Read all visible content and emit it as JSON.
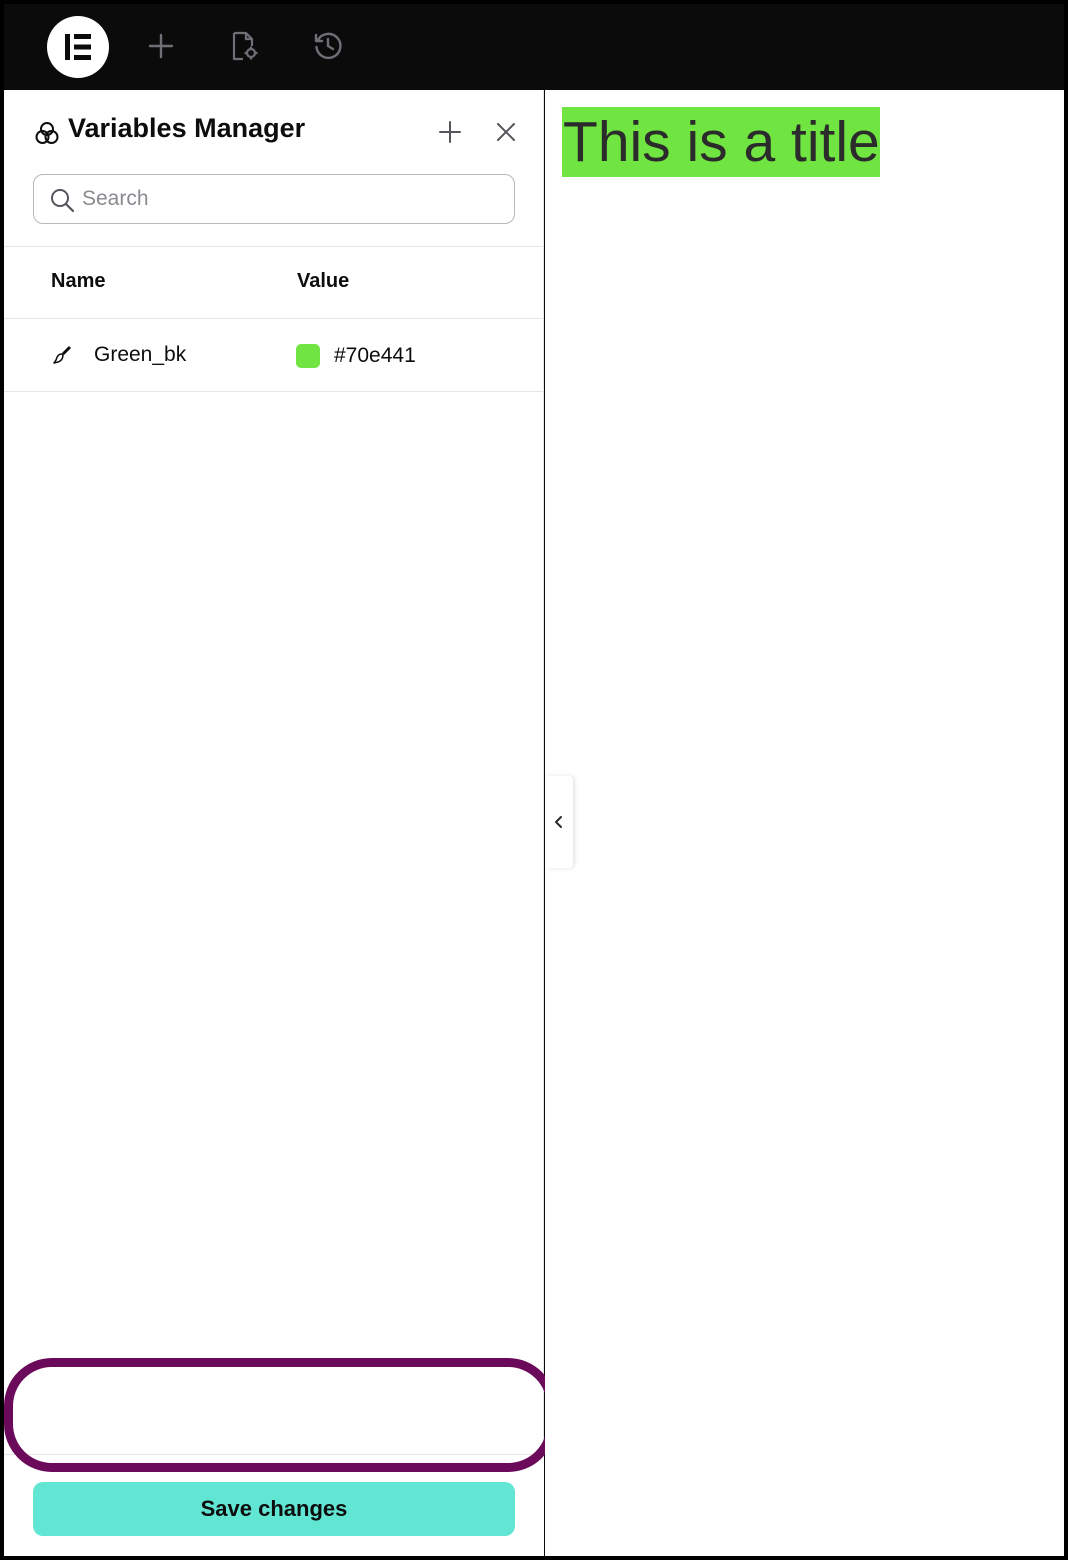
{
  "topbar": {
    "logo_icon": "elementor-logo-icon",
    "buttons": [
      {
        "icon": "plus-icon"
      },
      {
        "icon": "page-settings-icon"
      },
      {
        "icon": "history-icon"
      }
    ]
  },
  "panel": {
    "title": "Variables Manager",
    "title_icon": "variables-icon",
    "add_icon": "plus-icon",
    "close_icon": "close-icon",
    "search": {
      "placeholder": "Search",
      "value": ""
    },
    "columns": {
      "name": "Name",
      "value": "Value"
    },
    "variables": [
      {
        "icon": "brush-icon",
        "name": "Green_bk",
        "color": "#70e441",
        "value": "#70e441"
      }
    ],
    "save_label": "Save changes",
    "save_color": "#62e6d4",
    "highlight_color": "#6b0a5a"
  },
  "canvas": {
    "heading": "This is a title",
    "heading_bg": "#70e441",
    "collapse_icon": "chevron-left-icon"
  }
}
